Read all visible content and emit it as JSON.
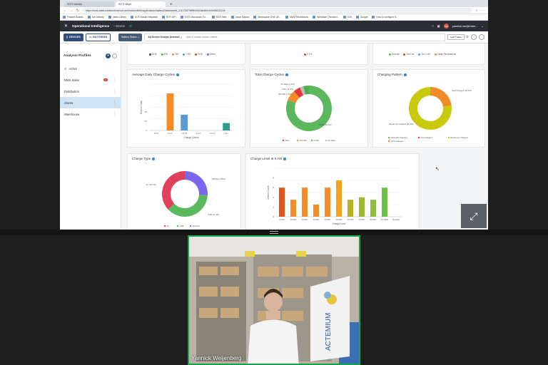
{
  "browser": {
    "tabs": [
      {
        "label": "SOTI Identity",
        "active": false
      },
      {
        "label": "SOTI Objet",
        "active": true
      }
    ],
    "url": "https://mxsi-sales.mobicontrolcloud.com/socloudintel/applications/batteryDashboard/s_411170679f89b0d92d6d40b4e9d9f3244242",
    "bookmarks": [
      "Feature Boards",
      "Get Identity",
      "Video Library",
      "SOTI Assist Helpdesk",
      "SOTI API",
      "SOTI Discussion Fo...",
      "SOTI Wiki",
      "Jason Baylon",
      "Workspace ONE UE...",
      "MDM Restrictions",
      "Webbase | Reconci...",
      "iOS",
      "Google",
      "How to configure S..."
    ]
  },
  "app": {
    "product": "Operational Intelligence",
    "breadcrumb": "Stores",
    "user": "yannick.we@mber...",
    "avatar": "YW"
  },
  "toolbar": {
    "devices": "DEVICES",
    "batteries": "BATTERIES",
    "status_select": "Battery Status",
    "group_select": "All Device Groups Selected",
    "filter_placeholder": "Add to create custom criteria",
    "range": "Last 7 days"
  },
  "sidebar": {
    "title": "Analysis Profiles",
    "items": [
      {
        "label": "Active",
        "badge": ""
      },
      {
        "label": "NMS Sales",
        "badge": "1"
      },
      {
        "label": "Distribution",
        "badge": ""
      },
      {
        "label": "Stores",
        "badge": ""
      },
      {
        "label": "Warehouse",
        "badge": ""
      }
    ]
  },
  "top_legends": {
    "left": [
      "DHS",
      "IHS",
      "360",
      "CHD",
      "EHS",
      "Other"
    ],
    "middle": [
      "0.7%"
    ],
    "right": [
      "Normal",
      "Too Hot",
      "Too Cold",
      "Large Fluctuations"
    ]
  },
  "charts": {
    "daily_cycles": {
      "title": "Average Daily Charge Cycles",
      "ylabel": "Device Count",
      "xlabel": "Charge Cycles",
      "categories": [
        "0-0.5",
        "0.5-1",
        "1.0-1.5",
        "1.5-2",
        "2.0-2.5",
        "2.5+"
      ],
      "values": [
        0,
        40,
        17,
        0,
        0,
        8
      ],
      "ylim": [
        0,
        50
      ],
      "colors": [
        "#f28c28",
        "#f28c28",
        "#5b9bd5",
        "#f28c28",
        "#f28c28",
        "#2a9d8f"
      ],
      "yticks": [
        "0",
        "10",
        "20"
      ]
    },
    "total_cycles": {
      "title": "Total Charge Cycles",
      "type": "pie",
      "slices": [
        {
          "label": "0-300 (81.0%)",
          "value": 81,
          "color": "#5cb85c"
        },
        {
          "label": "301-500 (7.5%)",
          "value": 7.5,
          "color": "#f28c28"
        },
        {
          "label": "500+ (5.0%)",
          "value": 5,
          "color": "#e03c3c"
        },
        {
          "label": "No Data (2.5%)",
          "value": 2.5,
          "color": "#bbbbbb"
        },
        {
          "label": "",
          "value": 4,
          "color": "#4caf50"
        }
      ],
      "legend": [
        "300+",
        "301-500",
        "0-300",
        "No Data"
      ]
    },
    "pattern": {
      "title": "Charging Pattern",
      "type": "pie",
      "slices": [
        {
          "label": "Spot Charged (22.9%)",
          "value": 22.9,
          "color": "#f28c28"
        },
        {
          "label": "Randomly Charged (81.0%)",
          "value": 77.1,
          "color": "#c9c90e"
        }
      ],
      "legend": [
        "Optimally Charged",
        "Overcharged",
        "Randomly Charged",
        "Spot Charged"
      ]
    },
    "charge_type": {
      "title": "Charge Type",
      "type": "pie",
      "slices": [
        {
          "label": "Wireless (26%)",
          "value": 26,
          "color": "#7b68ee"
        },
        {
          "label": "USB (37.1%)",
          "value": 37.1,
          "color": "#5cb85c"
        },
        {
          "label": "AC (36.7%)",
          "value": 36.9,
          "color": "#e0405a"
        }
      ],
      "legend": [
        "AC",
        "USB",
        "Wireless"
      ]
    },
    "charge_level": {
      "title": "Charge Level at 6 AM",
      "ylabel": "Device Count",
      "xlabel": "Charge Level",
      "categories": [
        "0-10%",
        "10-20%",
        "20-30%",
        "30-40%",
        "40-50%",
        "50-60%",
        "60-70%",
        "70-80%",
        "80-90%",
        "90-100%",
        "No Data"
      ],
      "values": [
        6,
        3.5,
        6,
        2.5,
        6,
        7.5,
        3.5,
        4,
        3.5,
        6,
        0
      ],
      "ylim": [
        0,
        10
      ],
      "colors": [
        "#e2531f",
        "#f28c28",
        "#f28c28",
        "#f28c28",
        "#f28c28",
        "#f6a21e",
        "#b7b322",
        "#9cbb33",
        "#8cc040",
        "#6cbf45",
        "#bbbbbb"
      ],
      "yticks": [
        "0",
        "2",
        "4",
        "6",
        "8"
      ]
    }
  },
  "video": {
    "participant": "Yannick Weijenberg",
    "banner_text": "ACTEMIUM"
  }
}
